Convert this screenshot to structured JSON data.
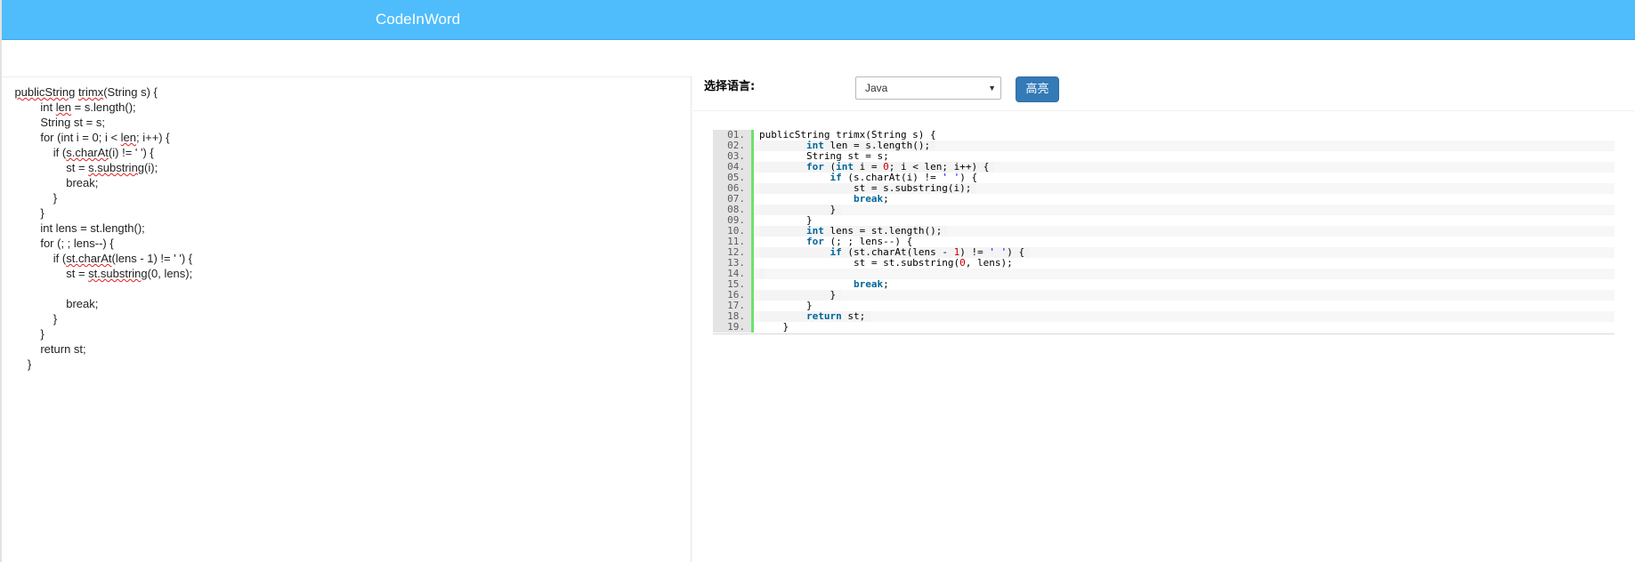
{
  "header": {
    "title": "CodeInWord"
  },
  "editor": {
    "lines": [
      [
        {
          "t": "    "
        },
        {
          "t": "publicString",
          "s": 1
        },
        {
          "t": " "
        },
        {
          "t": "trimx",
          "s": 1
        },
        {
          "t": "(String s) {"
        }
      ],
      [
        {
          "t": "            int "
        },
        {
          "t": "len",
          "s": 1
        },
        {
          "t": " = s.length();"
        }
      ],
      [
        {
          "t": "            String st = s;"
        }
      ],
      [
        {
          "t": "            for (int i = 0; i < "
        },
        {
          "t": "len",
          "s": 1
        },
        {
          "t": "; i++) {"
        }
      ],
      [
        {
          "t": "                if ("
        },
        {
          "t": "s.charAt",
          "s": 1
        },
        {
          "t": "(i) != ' ') {"
        }
      ],
      [
        {
          "t": "                    st = "
        },
        {
          "t": "s.substring",
          "s": 1
        },
        {
          "t": "(i);"
        }
      ],
      [
        {
          "t": "                    break;"
        }
      ],
      [
        {
          "t": "                }"
        }
      ],
      [
        {
          "t": "            }"
        }
      ],
      [
        {
          "t": "            int lens = st.length();"
        }
      ],
      [
        {
          "t": "            for (; ; lens--) {"
        }
      ],
      [
        {
          "t": "                if ("
        },
        {
          "t": "st.charAt",
          "s": 1
        },
        {
          "t": "(lens - 1) != ' ') {"
        }
      ],
      [
        {
          "t": "                    st = "
        },
        {
          "t": "st.substring",
          "s": 1
        },
        {
          "t": "(0, lens);"
        }
      ],
      [
        {
          "t": ""
        }
      ],
      [
        {
          "t": "                    break;"
        }
      ],
      [
        {
          "t": "                }"
        }
      ],
      [
        {
          "t": "            }"
        }
      ],
      [
        {
          "t": "            return st;"
        }
      ],
      [
        {
          "t": "        }"
        }
      ]
    ]
  },
  "controls": {
    "language_label": "选择语言:",
    "language_selected": "Java",
    "highlight_button": "高亮"
  },
  "highlighted": {
    "lines": [
      {
        "num": "01.",
        "tokens": [
          {
            "t": "publicString trimx(String s) {"
          }
        ]
      },
      {
        "num": "02.",
        "tokens": [
          {
            "t": "        "
          },
          {
            "t": "int",
            "k": "kw"
          },
          {
            "t": " len = s.length();"
          }
        ]
      },
      {
        "num": "03.",
        "tokens": [
          {
            "t": "        String st = s;"
          }
        ]
      },
      {
        "num": "04.",
        "tokens": [
          {
            "t": "        "
          },
          {
            "t": "for",
            "k": "kw"
          },
          {
            "t": " ("
          },
          {
            "t": "int",
            "k": "kw"
          },
          {
            "t": " i = "
          },
          {
            "t": "0",
            "k": "num"
          },
          {
            "t": "; i < len; i++) {"
          }
        ]
      },
      {
        "num": "05.",
        "tokens": [
          {
            "t": "            "
          },
          {
            "t": "if",
            "k": "kw"
          },
          {
            "t": " (s.charAt(i) != "
          },
          {
            "t": "' '",
            "k": "str"
          },
          {
            "t": ") {"
          }
        ]
      },
      {
        "num": "06.",
        "tokens": [
          {
            "t": "                st = s.substring(i);"
          }
        ]
      },
      {
        "num": "07.",
        "tokens": [
          {
            "t": "                "
          },
          {
            "t": "break",
            "k": "kw"
          },
          {
            "t": ";"
          }
        ]
      },
      {
        "num": "08.",
        "tokens": [
          {
            "t": "            }"
          }
        ]
      },
      {
        "num": "09.",
        "tokens": [
          {
            "t": "        }"
          }
        ]
      },
      {
        "num": "10.",
        "tokens": [
          {
            "t": "        "
          },
          {
            "t": "int",
            "k": "kw"
          },
          {
            "t": " lens = st.length();"
          }
        ]
      },
      {
        "num": "11.",
        "tokens": [
          {
            "t": "        "
          },
          {
            "t": "for",
            "k": "kw"
          },
          {
            "t": " (; ; lens--) {"
          }
        ]
      },
      {
        "num": "12.",
        "tokens": [
          {
            "t": "            "
          },
          {
            "t": "if",
            "k": "kw"
          },
          {
            "t": " (st.charAt(lens - "
          },
          {
            "t": "1",
            "k": "num"
          },
          {
            "t": ") != "
          },
          {
            "t": "' '",
            "k": "str"
          },
          {
            "t": ") {"
          }
        ]
      },
      {
        "num": "13.",
        "tokens": [
          {
            "t": "                st = st.substring("
          },
          {
            "t": "0",
            "k": "num"
          },
          {
            "t": ", lens);"
          }
        ]
      },
      {
        "num": "14.",
        "tokens": [
          {
            "t": ""
          }
        ]
      },
      {
        "num": "15.",
        "tokens": [
          {
            "t": "                "
          },
          {
            "t": "break",
            "k": "kw"
          },
          {
            "t": ";"
          }
        ]
      },
      {
        "num": "16.",
        "tokens": [
          {
            "t": "            }"
          }
        ]
      },
      {
        "num": "17.",
        "tokens": [
          {
            "t": "        }"
          }
        ]
      },
      {
        "num": "18.",
        "tokens": [
          {
            "t": "        "
          },
          {
            "t": "return",
            "k": "kw"
          },
          {
            "t": " st;"
          }
        ]
      },
      {
        "num": "19.",
        "tokens": [
          {
            "t": "    }"
          }
        ]
      }
    ]
  }
}
